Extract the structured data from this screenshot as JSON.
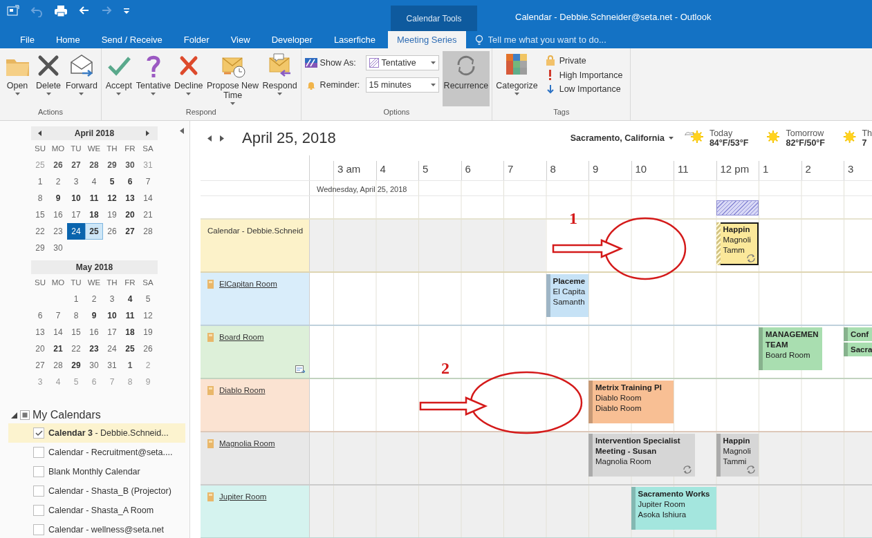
{
  "title_bar": {
    "context_tab": "Calendar Tools",
    "title": "Calendar - Debbie.Schneider@seta.net - Outlook"
  },
  "tabs": [
    {
      "label": "File",
      "selected": false
    },
    {
      "label": "Home",
      "selected": false
    },
    {
      "label": "Send / Receive",
      "selected": false
    },
    {
      "label": "Folder",
      "selected": false
    },
    {
      "label": "View",
      "selected": false
    },
    {
      "label": "Developer",
      "selected": false
    },
    {
      "label": "Laserfiche",
      "selected": false
    },
    {
      "label": "Meeting Series",
      "selected": true
    }
  ],
  "tell_me": {
    "placeholder": "Tell me what you want to do..."
  },
  "ribbon": {
    "groups": [
      {
        "label": "Actions",
        "kind": "buttons",
        "buttons": [
          {
            "label": "Open",
            "dropdown": true
          },
          {
            "label": "Delete",
            "dropdown": true
          },
          {
            "label": "Forward",
            "dropdown": true
          }
        ]
      },
      {
        "label": "Respond",
        "kind": "buttons",
        "buttons": [
          {
            "label": "Accept",
            "dropdown": true
          },
          {
            "label": "Tentative",
            "dropdown": true
          },
          {
            "label": "Decline",
            "dropdown": true
          },
          {
            "label": "Propose New Time",
            "dropdown": true
          },
          {
            "label": "Respond",
            "dropdown": true
          }
        ]
      },
      {
        "label": "Options",
        "kind": "options",
        "fields": [
          {
            "label": "Show As:",
            "value": "Tentative"
          },
          {
            "label": "Reminder:",
            "value": "15 minutes"
          }
        ],
        "buttons": [
          {
            "label": "Recurrence",
            "dropdown": false,
            "selected": true
          }
        ]
      },
      {
        "label": "Tags",
        "kind": "tags",
        "buttons": [
          {
            "label": "Categorize",
            "dropdown": true
          }
        ],
        "toggles": [
          {
            "label": "Private"
          },
          {
            "label": "High Importance"
          },
          {
            "label": "Low Importance"
          }
        ]
      }
    ]
  },
  "sidebar": {
    "mini_calendars": [
      {
        "title": "April 2018",
        "nav": true,
        "weekdays": [
          "SU",
          "MO",
          "TU",
          "WE",
          "TH",
          "FR",
          "SA"
        ],
        "weeks": [
          [
            {
              "d": "25",
              "bold": false,
              "dim": true,
              "today": false,
              "selected": false
            },
            {
              "d": "26",
              "bold": true,
              "dim": true,
              "today": false,
              "selected": false
            },
            {
              "d": "27",
              "bold": true,
              "dim": true,
              "today": false,
              "selected": false
            },
            {
              "d": "28",
              "bold": true,
              "dim": true,
              "today": false,
              "selected": false
            },
            {
              "d": "29",
              "bold": true,
              "dim": true,
              "today": false,
              "selected": false
            },
            {
              "d": "30",
              "bold": true,
              "dim": true,
              "today": false,
              "selected": false
            },
            {
              "d": "31",
              "bold": false,
              "dim": true,
              "today": false,
              "selected": false
            }
          ],
          [
            {
              "d": "1",
              "bold": false,
              "dim": false,
              "today": false,
              "selected": false
            },
            {
              "d": "2",
              "bold": false,
              "dim": false,
              "today": false,
              "selected": false
            },
            {
              "d": "3",
              "bold": false,
              "dim": false,
              "today": false,
              "selected": false
            },
            {
              "d": "4",
              "bold": false,
              "dim": false,
              "today": false,
              "selected": false
            },
            {
              "d": "5",
              "bold": true,
              "dim": false,
              "today": false,
              "selected": false
            },
            {
              "d": "6",
              "bold": true,
              "dim": false,
              "today": false,
              "selected": false
            },
            {
              "d": "7",
              "bold": false,
              "dim": false,
              "today": false,
              "selected": false
            }
          ],
          [
            {
              "d": "8",
              "bold": false,
              "dim": false,
              "today": false,
              "selected": false
            },
            {
              "d": "9",
              "bold": true,
              "dim": false,
              "today": false,
              "selected": false
            },
            {
              "d": "10",
              "bold": true,
              "dim": false,
              "today": false,
              "selected": false
            },
            {
              "d": "11",
              "bold": true,
              "dim": false,
              "today": false,
              "selected": false
            },
            {
              "d": "12",
              "bold": true,
              "dim": false,
              "today": false,
              "selected": false
            },
            {
              "d": "13",
              "bold": true,
              "dim": false,
              "today": false,
              "selected": false
            },
            {
              "d": "14",
              "bold": false,
              "dim": false,
              "today": false,
              "selected": false
            }
          ],
          [
            {
              "d": "15",
              "bold": false,
              "dim": false,
              "today": false,
              "selected": false
            },
            {
              "d": "16",
              "bold": false,
              "dim": false,
              "today": false,
              "selected": false
            },
            {
              "d": "17",
              "bold": false,
              "dim": false,
              "today": false,
              "selected": false
            },
            {
              "d": "18",
              "bold": true,
              "dim": false,
              "today": false,
              "selected": false
            },
            {
              "d": "19",
              "bold": false,
              "dim": false,
              "today": false,
              "selected": false
            },
            {
              "d": "20",
              "bold": true,
              "dim": false,
              "today": false,
              "selected": false
            },
            {
              "d": "21",
              "bold": false,
              "dim": false,
              "today": false,
              "selected": false
            }
          ],
          [
            {
              "d": "22",
              "bold": false,
              "dim": false,
              "today": false,
              "selected": false
            },
            {
              "d": "23",
              "bold": false,
              "dim": false,
              "today": false,
              "selected": false
            },
            {
              "d": "24",
              "bold": false,
              "dim": false,
              "today": true,
              "selected": false
            },
            {
              "d": "25",
              "bold": true,
              "dim": false,
              "today": false,
              "selected": true
            },
            {
              "d": "26",
              "bold": false,
              "dim": false,
              "today": false,
              "selected": false
            },
            {
              "d": "27",
              "bold": true,
              "dim": false,
              "today": false,
              "selected": false
            },
            {
              "d": "28",
              "bold": false,
              "dim": false,
              "today": false,
              "selected": false
            }
          ],
          [
            {
              "d": "29",
              "bold": false,
              "dim": false,
              "today": false,
              "selected": false
            },
            {
              "d": "30",
              "bold": false,
              "dim": false,
              "today": false,
              "selected": false
            }
          ]
        ]
      },
      {
        "title": "May 2018",
        "nav": false,
        "weekdays": [
          "SU",
          "MO",
          "TU",
          "WE",
          "TH",
          "FR",
          "SA"
        ],
        "weeks": [
          [
            {
              "d": "1",
              "bold": false,
              "dim": false,
              "today": false,
              "selected": false
            },
            {
              "d": "2",
              "bold": false,
              "dim": false,
              "today": false,
              "selected": false
            },
            {
              "d": "3",
              "bold": false,
              "dim": false,
              "today": false,
              "selected": false
            },
            {
              "d": "4",
              "bold": true,
              "dim": false,
              "today": false,
              "selected": false
            },
            {
              "d": "5",
              "bold": false,
              "dim": false,
              "today": false,
              "selected": false
            }
          ],
          [
            {
              "d": "6",
              "bold": false,
              "dim": false,
              "today": false,
              "selected": false
            },
            {
              "d": "7",
              "bold": false,
              "dim": false,
              "today": false,
              "selected": false
            },
            {
              "d": "8",
              "bold": false,
              "dim": false,
              "today": false,
              "selected": false
            },
            {
              "d": "9",
              "bold": true,
              "dim": false,
              "today": false,
              "selected": false
            },
            {
              "d": "10",
              "bold": true,
              "dim": false,
              "today": false,
              "selected": false
            },
            {
              "d": "11",
              "bold": true,
              "dim": false,
              "today": false,
              "selected": false
            },
            {
              "d": "12",
              "bold": false,
              "dim": false,
              "today": false,
              "selected": false
            }
          ],
          [
            {
              "d": "13",
              "bold": false,
              "dim": false,
              "today": false,
              "selected": false
            },
            {
              "d": "14",
              "bold": false,
              "dim": false,
              "today": false,
              "selected": false
            },
            {
              "d": "15",
              "bold": false,
              "dim": false,
              "today": false,
              "selected": false
            },
            {
              "d": "16",
              "bold": false,
              "dim": false,
              "today": false,
              "selected": false
            },
            {
              "d": "17",
              "bold": false,
              "dim": false,
              "today": false,
              "selected": false
            },
            {
              "d": "18",
              "bold": true,
              "dim": false,
              "today": false,
              "selected": false
            },
            {
              "d": "19",
              "bold": false,
              "dim": false,
              "today": false,
              "selected": false
            }
          ],
          [
            {
              "d": "20",
              "bold": false,
              "dim": false,
              "today": false,
              "selected": false
            },
            {
              "d": "21",
              "bold": true,
              "dim": false,
              "today": false,
              "selected": false
            },
            {
              "d": "22",
              "bold": false,
              "dim": false,
              "today": false,
              "selected": false
            },
            {
              "d": "23",
              "bold": true,
              "dim": false,
              "today": false,
              "selected": false
            },
            {
              "d": "24",
              "bold": false,
              "dim": false,
              "today": false,
              "selected": false
            },
            {
              "d": "25",
              "bold": true,
              "dim": false,
              "today": false,
              "selected": false
            },
            {
              "d": "26",
              "bold": false,
              "dim": false,
              "today": false,
              "selected": false
            }
          ],
          [
            {
              "d": "27",
              "bold": false,
              "dim": false,
              "today": false,
              "selected": false
            },
            {
              "d": "28",
              "bold": false,
              "dim": false,
              "today": false,
              "selected": false
            },
            {
              "d": "29",
              "bold": true,
              "dim": false,
              "today": false,
              "selected": false
            },
            {
              "d": "30",
              "bold": false,
              "dim": false,
              "today": false,
              "selected": false
            },
            {
              "d": "31",
              "bold": false,
              "dim": false,
              "today": false,
              "selected": false
            },
            {
              "d": "1",
              "bold": true,
              "dim": true,
              "today": false,
              "selected": false
            },
            {
              "d": "2",
              "bold": false,
              "dim": true,
              "today": false,
              "selected": false
            }
          ],
          [
            {
              "d": "3",
              "bold": false,
              "dim": true,
              "today": false,
              "selected": false
            },
            {
              "d": "4",
              "bold": false,
              "dim": true,
              "today": false,
              "selected": false
            },
            {
              "d": "5",
              "bold": false,
              "dim": true,
              "today": false,
              "selected": false
            },
            {
              "d": "6",
              "bold": false,
              "dim": true,
              "today": false,
              "selected": false
            },
            {
              "d": "7",
              "bold": false,
              "dim": true,
              "today": false,
              "selected": false
            },
            {
              "d": "8",
              "bold": false,
              "dim": true,
              "today": false,
              "selected": false
            },
            {
              "d": "9",
              "bold": false,
              "dim": true,
              "today": false,
              "selected": false
            }
          ]
        ]
      }
    ],
    "calendar_groups": [
      {
        "label": "My Calendars",
        "expanded": true,
        "items": [
          {
            "label": "**Calendar  3** - Debbie.Schneid...",
            "checked": true,
            "selected": true
          },
          {
            "label": "Calendar - Recruitment@seta....",
            "checked": false,
            "selected": false
          },
          {
            "label": "Blank Monthly Calendar",
            "checked": false,
            "selected": false
          },
          {
            "label": "Calendar - Shasta_B (Projector)",
            "checked": false,
            "selected": false
          },
          {
            "label": "Calendar - Shasta_A Room",
            "checked": false,
            "selected": false
          },
          {
            "label": "Calendar - wellness@seta.net",
            "checked": false,
            "selected": false
          }
        ]
      }
    ]
  },
  "calendar_view": {
    "title": "April 25, 2018",
    "location": "Sacramento, California",
    "forecast": [
      {
        "day": "Today",
        "temp": "84°F/53°F"
      },
      {
        "day": "Tomorrow",
        "temp": "82°F/50°F"
      },
      {
        "day": "Th",
        "temp": "7"
      }
    ],
    "hours": [
      "3 am",
      "4",
      "5",
      "6",
      "7",
      "8",
      "9",
      "10",
      "11",
      "12 pm",
      "1",
      "2",
      "3"
    ],
    "date_label": "Wednesday, April 25, 2018",
    "rows": [
      {
        "name": "Calendar - Debbie.Schneid",
        "kind": "calendar",
        "color": "#fcf2c9",
        "shaded": false,
        "events": [
          {
            "title": "Happin",
            "lines": [
              "Magnoli",
              "Tamm"
            ],
            "color": "#fbe89a",
            "selected": true,
            "tentative": true,
            "recurring": true
          }
        ]
      },
      {
        "name": "ElCapitan Room",
        "kind": "room",
        "color": "#d9edfa",
        "shaded": false,
        "events": [
          {
            "title": "Placeme",
            "lines": [
              "El Capita",
              "Samanth"
            ],
            "color": "#c6e2f6",
            "selected": false,
            "tentative": false,
            "recurring": false
          }
        ]
      },
      {
        "name": "Board Room",
        "kind": "room",
        "color": "#ddf0d9",
        "shaded": false,
        "events": [
          {
            "title": "MANAGEMEN TEAM",
            "lines": [
              "Board Room"
            ],
            "color": "#a9deb0",
            "selected": false,
            "tentative": false,
            "recurring": false
          },
          {
            "title": "Conf",
            "color": "#a9deb0",
            "selected": false,
            "tentative": false,
            "recurring": false
          },
          {
            "title": "Sacra",
            "color": "#a9deb0",
            "selected": false,
            "tentative": false,
            "recurring": false
          }
        ]
      },
      {
        "name": "Diablo Room",
        "kind": "room",
        "color": "#fbe3d2",
        "shaded": false,
        "events": [
          {
            "title": "Metrix Training Pl",
            "lines": [
              "Diablo Room",
              "Diablo Room"
            ],
            "color": "#f8bf94",
            "selected": false,
            "tentative": false,
            "recurring": false
          }
        ]
      },
      {
        "name": "Magnolia Room",
        "kind": "room",
        "color": "#e8e8e8",
        "shaded": true,
        "events": [
          {
            "title": "Intervention Specialist Meeting - Susan",
            "lines": [
              "Magnolia Room"
            ],
            "color": "#d6d6d6",
            "selected": false,
            "tentative": false,
            "recurring": true
          },
          {
            "title": "Happin",
            "lines": [
              "Magnoli",
              "Tammi"
            ],
            "color": "#d6d6d6",
            "selected": false,
            "tentative": false,
            "recurring": true
          }
        ]
      },
      {
        "name": "Jupiter Room",
        "kind": "room",
        "color": "#d5f3ef",
        "shaded": true,
        "events": [
          {
            "title": "Sacramento Works",
            "lines": [
              "Jupiter Room",
              "Asoka Ishiura"
            ],
            "color": "#a4e6de",
            "selected": false,
            "tentative": false,
            "recurring": false
          }
        ]
      }
    ]
  },
  "annotations": [
    {
      "label": "1"
    },
    {
      "label": "2"
    }
  ]
}
